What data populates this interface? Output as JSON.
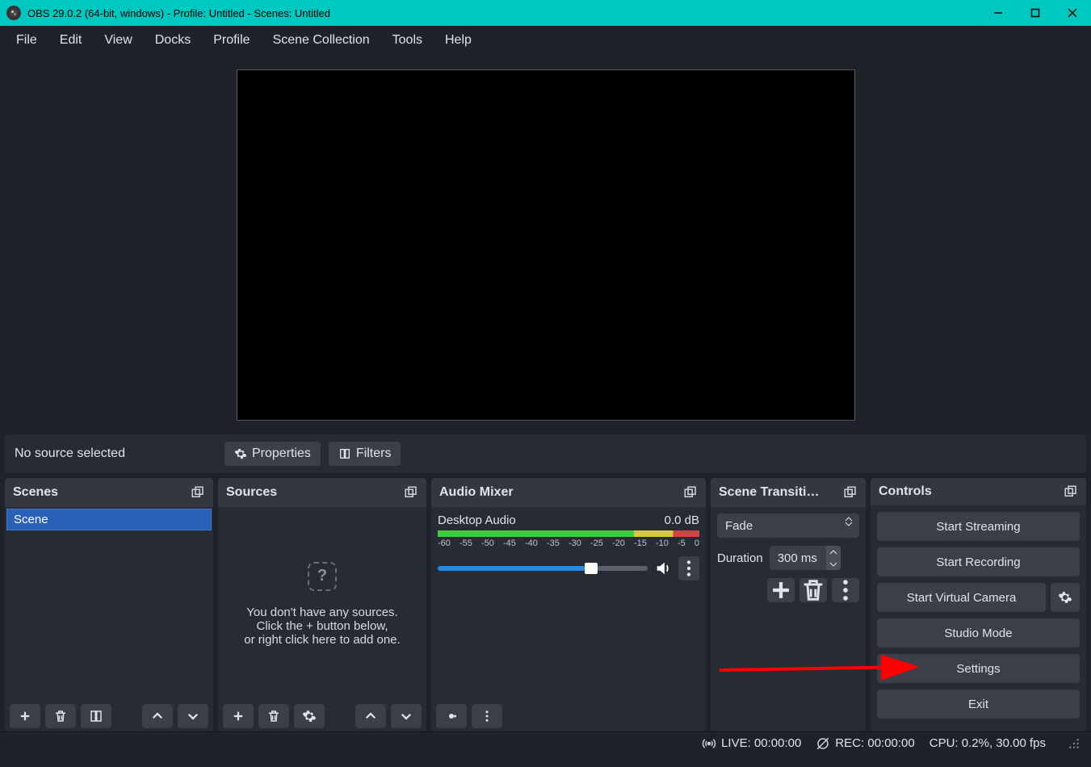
{
  "titlebar": {
    "title": "OBS 29.0.2 (64-bit, windows) - Profile: Untitled - Scenes: Untitled"
  },
  "menu": [
    "File",
    "Edit",
    "View",
    "Docks",
    "Profile",
    "Scene Collection",
    "Tools",
    "Help"
  ],
  "sourceToolbar": {
    "noSource": "No source selected",
    "properties": "Properties",
    "filters": "Filters"
  },
  "docks": {
    "scenes": {
      "title": "Scenes",
      "items": [
        "Scene"
      ]
    },
    "sources": {
      "title": "Sources",
      "emptyL1": "You don't have any sources.",
      "emptyL2": "Click the + button below,",
      "emptyL3": "or right click here to add one."
    },
    "mixer": {
      "title": "Audio Mixer",
      "track": "Desktop Audio",
      "level": "0.0 dB",
      "ticks": [
        "-60",
        "-55",
        "-50",
        "-45",
        "-40",
        "-35",
        "-30",
        "-25",
        "-20",
        "-15",
        "-10",
        "-5",
        "0"
      ]
    },
    "transitions": {
      "title": "Scene Transiti…",
      "selected": "Fade",
      "durationLabel": "Duration",
      "duration": "300 ms"
    },
    "controls": {
      "title": "Controls",
      "buttons": [
        "Start Streaming",
        "Start Recording",
        "Start Virtual Camera",
        "Studio Mode",
        "Settings",
        "Exit"
      ]
    }
  },
  "statusbar": {
    "live": "LIVE: 00:00:00",
    "rec": "REC: 00:00:00",
    "cpu": "CPU: 0.2%, 30.00 fps"
  }
}
